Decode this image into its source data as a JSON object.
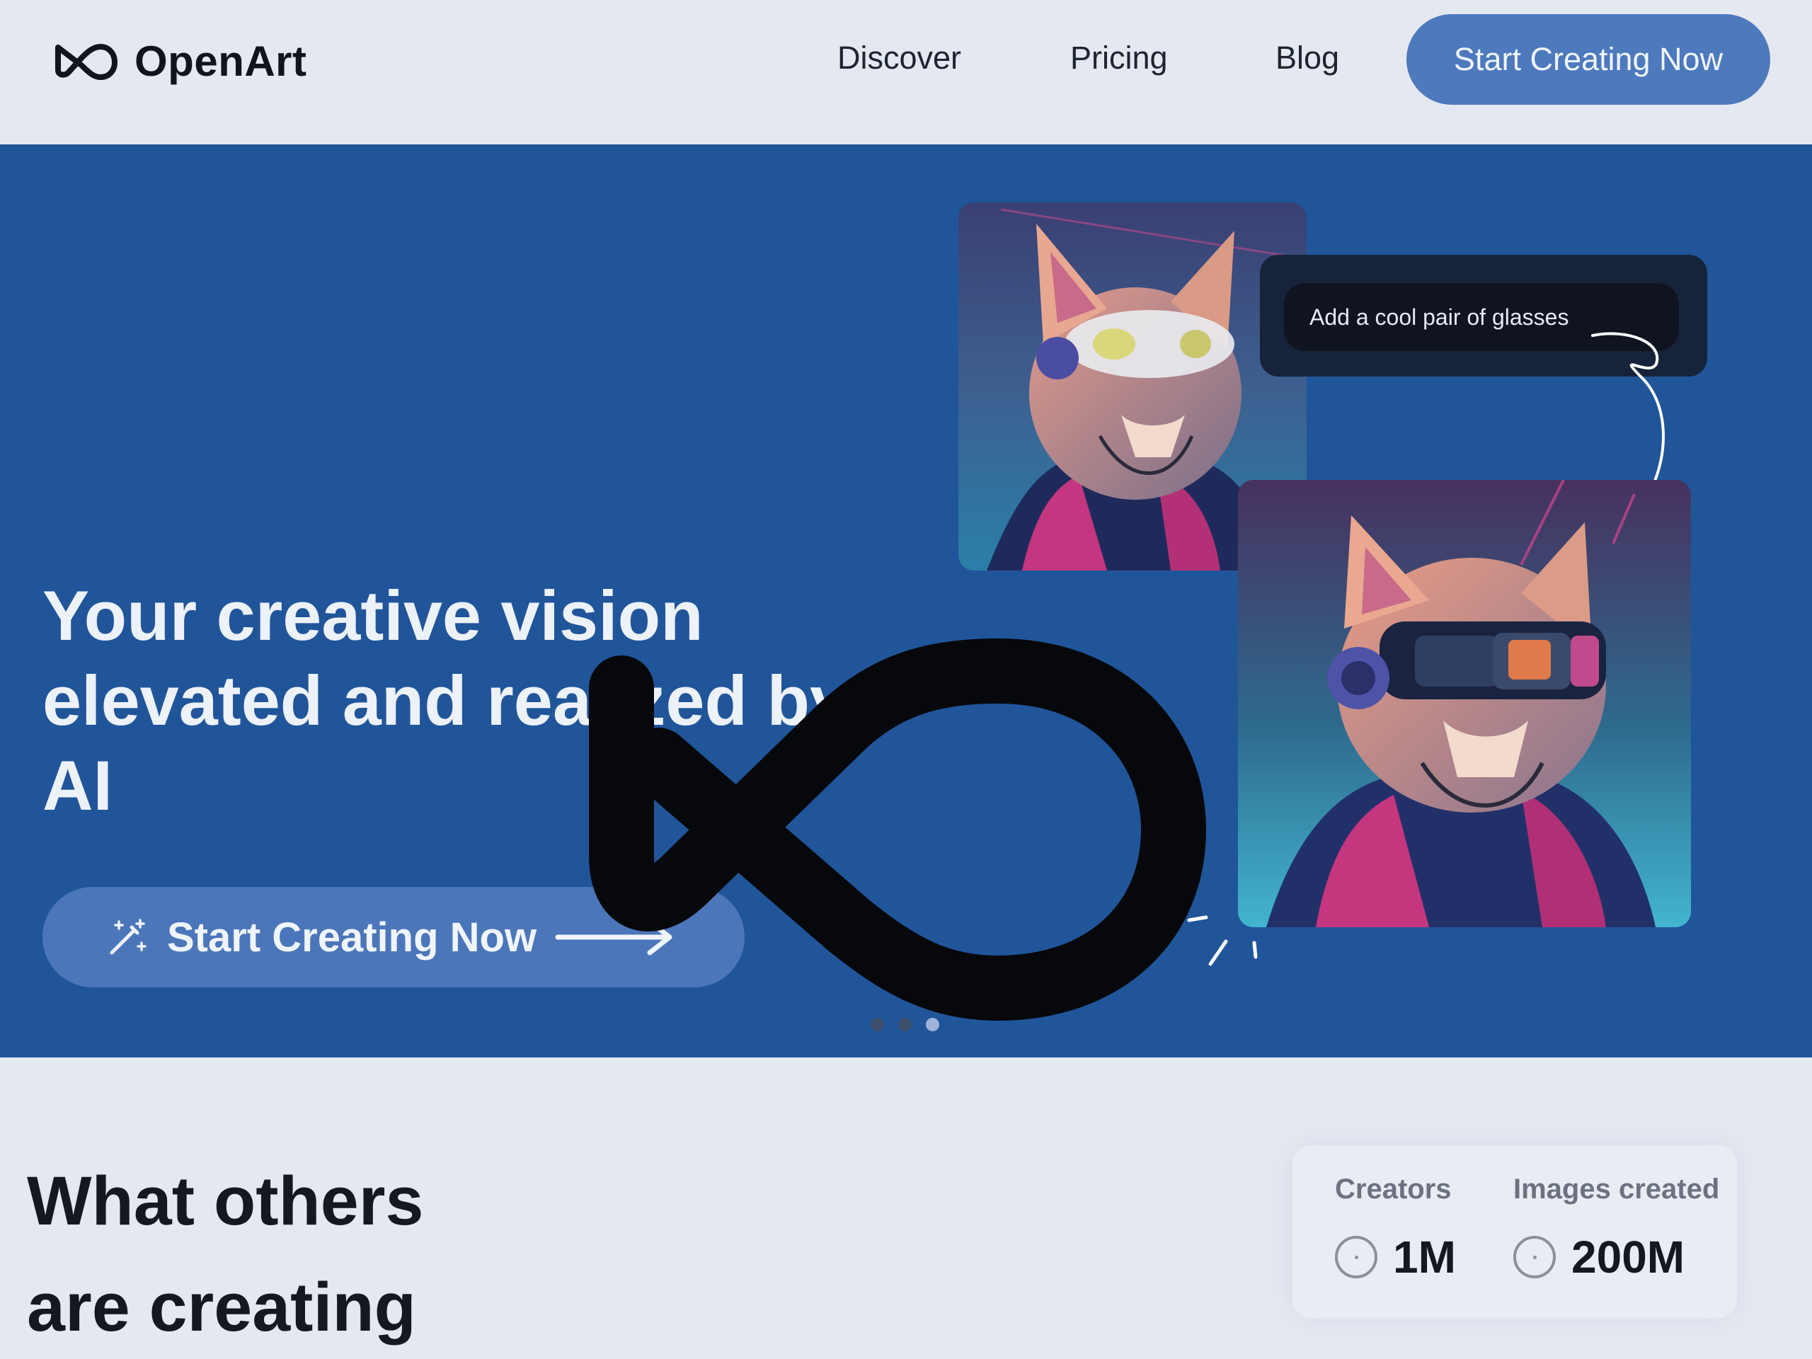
{
  "nav": {
    "brand": "OpenArt",
    "links": [
      "Discover",
      "Pricing",
      "Blog"
    ],
    "cta": "Start Creating Now"
  },
  "hero": {
    "title_lines": [
      "Your creative vision",
      "elevated and realized by",
      "AI"
    ],
    "cta": "Start Creating Now",
    "prompt": "Add a cool pair of glasses",
    "carousel_dots": 3,
    "active_dot": 3
  },
  "section": {
    "title_lines": [
      "What others",
      "are creating"
    ]
  },
  "stats": [
    {
      "label": "Creators",
      "value": "1M"
    },
    {
      "label": "Images created",
      "value": "200M"
    }
  ],
  "colors": {
    "hero_bg": "#20559a",
    "button": "#4d79bd",
    "page_bg": "#e4e8f1"
  }
}
